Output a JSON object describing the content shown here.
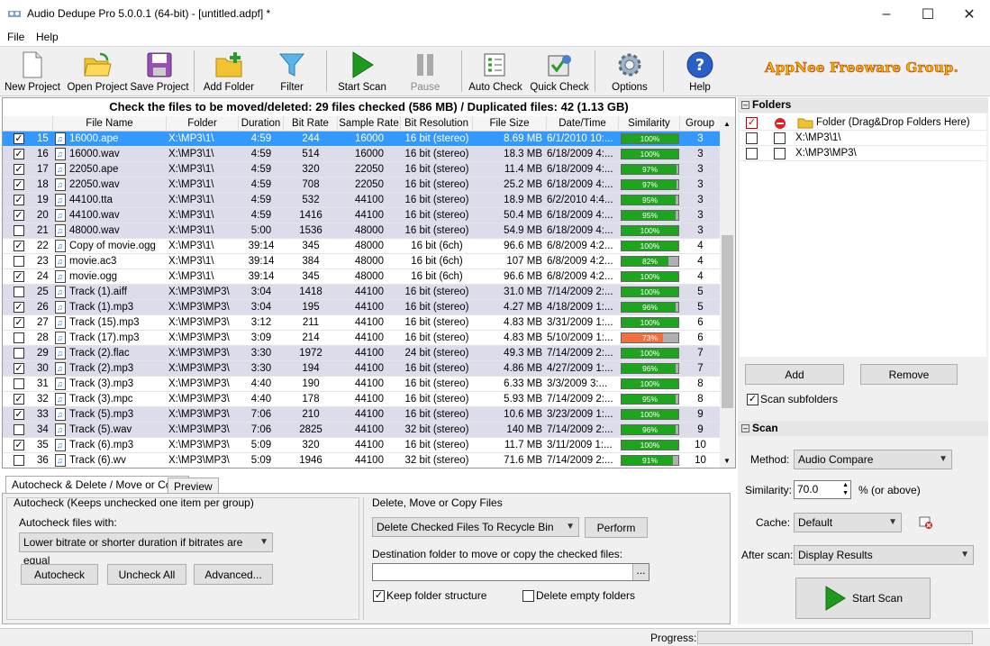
{
  "window": {
    "title": "Audio Dedupe Pro 5.0.0.1 (64-bit) - [untitled.adpf] *"
  },
  "menu": [
    "File",
    "Help"
  ],
  "toolbar": {
    "new_project": "New Project",
    "open_project": "Open Project",
    "save_project": "Save Project",
    "add_folder": "Add Folder",
    "filter": "Filter",
    "start_scan": "Start Scan",
    "pause": "Pause",
    "auto_check": "Auto Check",
    "quick_check": "Quick Check",
    "options": "Options",
    "help": "Help"
  },
  "brand": "AppNee Freeware Group.",
  "summary": "Check the files to be moved/deleted: 29 files checked (586 MB) / Duplicated files: 42 (1.13 GB)",
  "table": {
    "columns": [
      "File Name",
      "Folder",
      "Duration",
      "Bit Rate",
      "Sample Rate",
      "Bit Resolution",
      "File Size",
      "Date/Time",
      "Similarity",
      "Group"
    ],
    "rows": [
      {
        "num": "15",
        "checked": true,
        "name": "16000.ape",
        "folder": "X:\\MP3\\1\\",
        "duration": "4:59",
        "bitrate": "244",
        "sample": "16000",
        "res": "16 bit (stereo)",
        "size": "8.69 MB",
        "date": "6/1/2010 10:...",
        "sim": 100,
        "simtxt": "100%",
        "group": "3",
        "selected": true,
        "shade": 0
      },
      {
        "num": "16",
        "checked": true,
        "name": "16000.wav",
        "folder": "X:\\MP3\\1\\",
        "duration": "4:59",
        "bitrate": "514",
        "sample": "16000",
        "res": "16 bit (stereo)",
        "size": "18.3 MB",
        "date": "6/18/2009 4:...",
        "sim": 100,
        "simtxt": "100%",
        "group": "3",
        "selected": false,
        "shade": 1
      },
      {
        "num": "17",
        "checked": true,
        "name": "22050.ape",
        "folder": "X:\\MP3\\1\\",
        "duration": "4:59",
        "bitrate": "320",
        "sample": "22050",
        "res": "16 bit (stereo)",
        "size": "11.4 MB",
        "date": "6/18/2009 4:...",
        "sim": 97,
        "simtxt": "97%",
        "group": "3",
        "selected": false,
        "shade": 1
      },
      {
        "num": "18",
        "checked": true,
        "name": "22050.wav",
        "folder": "X:\\MP3\\1\\",
        "duration": "4:59",
        "bitrate": "708",
        "sample": "22050",
        "res": "16 bit (stereo)",
        "size": "25.2 MB",
        "date": "6/18/2009 4:...",
        "sim": 97,
        "simtxt": "97%",
        "group": "3",
        "selected": false,
        "shade": 1
      },
      {
        "num": "19",
        "checked": true,
        "name": "44100.tta",
        "folder": "X:\\MP3\\1\\",
        "duration": "4:59",
        "bitrate": "532",
        "sample": "44100",
        "res": "16 bit (stereo)",
        "size": "18.9 MB",
        "date": "6/2/2010 4:4...",
        "sim": 95,
        "simtxt": "95%",
        "group": "3",
        "selected": false,
        "shade": 1
      },
      {
        "num": "20",
        "checked": true,
        "name": "44100.wav",
        "folder": "X:\\MP3\\1\\",
        "duration": "4:59",
        "bitrate": "1416",
        "sample": "44100",
        "res": "16 bit (stereo)",
        "size": "50.4 MB",
        "date": "6/18/2009 4:...",
        "sim": 95,
        "simtxt": "95%",
        "group": "3",
        "selected": false,
        "shade": 1
      },
      {
        "num": "21",
        "checked": false,
        "name": "48000.wav",
        "folder": "X:\\MP3\\1\\",
        "duration": "5:00",
        "bitrate": "1536",
        "sample": "48000",
        "res": "16 bit (stereo)",
        "size": "54.9 MB",
        "date": "6/18/2009 4:...",
        "sim": 100,
        "simtxt": "100%",
        "group": "3",
        "selected": false,
        "shade": 1
      },
      {
        "num": "22",
        "checked": true,
        "name": "Copy of movie.ogg",
        "folder": "X:\\MP3\\1\\",
        "duration": "39:14",
        "bitrate": "345",
        "sample": "48000",
        "res": "16 bit (6ch)",
        "size": "96.6 MB",
        "date": "6/8/2009 4:2...",
        "sim": 100,
        "simtxt": "100%",
        "group": "4",
        "selected": false,
        "shade": 0
      },
      {
        "num": "23",
        "checked": false,
        "name": "movie.ac3",
        "folder": "X:\\MP3\\1\\",
        "duration": "39:14",
        "bitrate": "384",
        "sample": "48000",
        "res": "16 bit (6ch)",
        "size": "107 MB",
        "date": "6/8/2009 4:2...",
        "sim": 82,
        "simtxt": "82%",
        "group": "4",
        "selected": false,
        "shade": 0
      },
      {
        "num": "24",
        "checked": true,
        "name": "movie.ogg",
        "folder": "X:\\MP3\\1\\",
        "duration": "39:14",
        "bitrate": "345",
        "sample": "48000",
        "res": "16 bit (6ch)",
        "size": "96.6 MB",
        "date": "6/8/2009 4:2...",
        "sim": 100,
        "simtxt": "100%",
        "group": "4",
        "selected": false,
        "shade": 0
      },
      {
        "num": "25",
        "checked": false,
        "name": "Track (1).aiff",
        "folder": "X:\\MP3\\MP3\\",
        "duration": "3:04",
        "bitrate": "1418",
        "sample": "44100",
        "res": "16 bit (stereo)",
        "size": "31.0 MB",
        "date": "7/14/2009 2:...",
        "sim": 100,
        "simtxt": "100%",
        "group": "5",
        "selected": false,
        "shade": 1
      },
      {
        "num": "26",
        "checked": true,
        "name": "Track (1).mp3",
        "folder": "X:\\MP3\\MP3\\",
        "duration": "3:04",
        "bitrate": "195",
        "sample": "44100",
        "res": "16 bit (stereo)",
        "size": "4.27 MB",
        "date": "4/18/2009 1:...",
        "sim": 96,
        "simtxt": "96%",
        "group": "5",
        "selected": false,
        "shade": 1
      },
      {
        "num": "27",
        "checked": true,
        "name": "Track (15).mp3",
        "folder": "X:\\MP3\\MP3\\",
        "duration": "3:12",
        "bitrate": "211",
        "sample": "44100",
        "res": "16 bit (stereo)",
        "size": "4.83 MB",
        "date": "3/31/2009 1:...",
        "sim": 100,
        "simtxt": "100%",
        "group": "6",
        "selected": false,
        "shade": 0
      },
      {
        "num": "28",
        "checked": false,
        "name": "Track (17).mp3",
        "folder": "X:\\MP3\\MP3\\",
        "duration": "3:09",
        "bitrate": "214",
        "sample": "44100",
        "res": "16 bit (stereo)",
        "size": "4.83 MB",
        "date": "5/10/2009 1:...",
        "sim": 73,
        "simtxt": "73%",
        "group": "6",
        "selected": false,
        "shade": 0
      },
      {
        "num": "29",
        "checked": false,
        "name": "Track (2).flac",
        "folder": "X:\\MP3\\MP3\\",
        "duration": "3:30",
        "bitrate": "1972",
        "sample": "44100",
        "res": "24 bit (stereo)",
        "size": "49.3 MB",
        "date": "7/14/2009 2:...",
        "sim": 100,
        "simtxt": "100%",
        "group": "7",
        "selected": false,
        "shade": 1
      },
      {
        "num": "30",
        "checked": true,
        "name": "Track (2).mp3",
        "folder": "X:\\MP3\\MP3\\",
        "duration": "3:30",
        "bitrate": "194",
        "sample": "44100",
        "res": "16 bit (stereo)",
        "size": "4.86 MB",
        "date": "4/27/2009 1:...",
        "sim": 96,
        "simtxt": "96%",
        "group": "7",
        "selected": false,
        "shade": 1
      },
      {
        "num": "31",
        "checked": false,
        "name": "Track (3).mp3",
        "folder": "X:\\MP3\\MP3\\",
        "duration": "4:40",
        "bitrate": "190",
        "sample": "44100",
        "res": "16 bit (stereo)",
        "size": "6.33 MB",
        "date": "3/3/2009 3:...",
        "sim": 100,
        "simtxt": "100%",
        "group": "8",
        "selected": false,
        "shade": 0
      },
      {
        "num": "32",
        "checked": true,
        "name": "Track (3).mpc",
        "folder": "X:\\MP3\\MP3\\",
        "duration": "4:40",
        "bitrate": "178",
        "sample": "44100",
        "res": "16 bit (stereo)",
        "size": "5.93 MB",
        "date": "7/14/2009 2:...",
        "sim": 95,
        "simtxt": "95%",
        "group": "8",
        "selected": false,
        "shade": 0
      },
      {
        "num": "33",
        "checked": true,
        "name": "Track (5).mp3",
        "folder": "X:\\MP3\\MP3\\",
        "duration": "7:06",
        "bitrate": "210",
        "sample": "44100",
        "res": "16 bit (stereo)",
        "size": "10.6 MB",
        "date": "3/23/2009 1:...",
        "sim": 100,
        "simtxt": "100%",
        "group": "9",
        "selected": false,
        "shade": 1
      },
      {
        "num": "34",
        "checked": false,
        "name": "Track (5).wav",
        "folder": "X:\\MP3\\MP3\\",
        "duration": "7:06",
        "bitrate": "2825",
        "sample": "44100",
        "res": "32 bit (stereo)",
        "size": "140 MB",
        "date": "7/14/2009 2:...",
        "sim": 96,
        "simtxt": "96%",
        "group": "9",
        "selected": false,
        "shade": 1
      },
      {
        "num": "35",
        "checked": true,
        "name": "Track (6).mp3",
        "folder": "X:\\MP3\\MP3\\",
        "duration": "5:09",
        "bitrate": "320",
        "sample": "44100",
        "res": "16 bit (stereo)",
        "size": "11.7 MB",
        "date": "3/11/2009 1:...",
        "sim": 100,
        "simtxt": "100%",
        "group": "10",
        "selected": false,
        "shade": 0
      },
      {
        "num": "36",
        "checked": false,
        "name": "Track (6).wv",
        "folder": "X:\\MP3\\MP3\\",
        "duration": "5:09",
        "bitrate": "1946",
        "sample": "44100",
        "res": "32 bit (stereo)",
        "size": "71.6 MB",
        "date": "7/14/2009 2:...",
        "sim": 91,
        "simtxt": "91%",
        "group": "10",
        "selected": false,
        "shade": 0
      }
    ]
  },
  "tabs": {
    "autocheck": "Autocheck & Delete / Move or Copy",
    "preview": "Preview"
  },
  "autocheck": {
    "group_label": "Autocheck (Keeps unchecked one item per group)",
    "files_with_label": "Autocheck files with:",
    "files_with_value": "Lower bitrate or shorter duration if bitrates are equal",
    "autocheck_btn": "Autocheck",
    "uncheck_all_btn": "Uncheck All",
    "advanced_btn": "Advanced..."
  },
  "delete": {
    "group_label": "Delete, Move or Copy Files",
    "action_value": "Delete Checked Files To Recycle Bin",
    "perform_btn": "Perform",
    "dest_label": "Destination folder to move or copy the checked files:",
    "dest_value": "",
    "browse_btn": "...",
    "keep_structure": "Keep folder structure",
    "delete_empty": "Delete empty folders"
  },
  "folders": {
    "header": "Folders",
    "placeholder": "Folder (Drag&Drop Folders Here)",
    "items": [
      "X:\\MP3\\1\\",
      "X:\\MP3\\MP3\\"
    ],
    "add_btn": "Add",
    "remove_btn": "Remove",
    "scan_subfolders": "Scan subfolders"
  },
  "scan": {
    "header": "Scan",
    "method_label": "Method:",
    "method_value": "Audio Compare",
    "similarity_label": "Similarity:",
    "similarity_value": "70.0",
    "similarity_unit": "% (or above)",
    "cache_label": "Cache:",
    "cache_value": "Default",
    "after_scan_label": "After scan:",
    "after_scan_value": "Display Results",
    "start_btn": "Start Scan"
  },
  "status": {
    "progress_label": "Progress:"
  }
}
